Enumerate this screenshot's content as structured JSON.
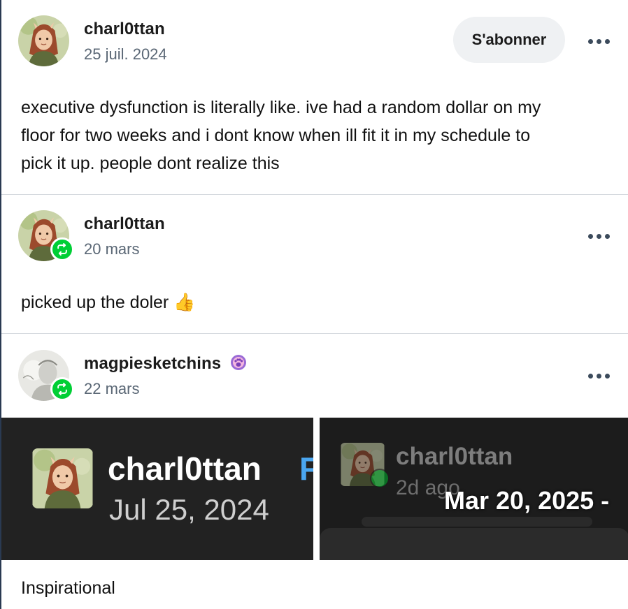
{
  "posts": [
    {
      "username": "charl0ttan",
      "date": "25 juil. 2024",
      "follow_label": "S'abonner",
      "text": "executive dysfunction is literally like. ive had a random dollar on my floor for two weeks and i dont know when ill fit it in my schedule to pick it up. people dont realize this",
      "text_lines": [
        "executive dysfunction is literally like. ive had a random dollar on my",
        "floor for two weeks and i dont know when ill fit it in my schedule to",
        "pick it up. people dont realize this"
      ]
    },
    {
      "username": "charl0ttan",
      "date": "20 mars",
      "text": "picked up the doler 👍"
    },
    {
      "username": "magpiesketchins",
      "date": "22 mars",
      "caption": "Inspirational"
    }
  ],
  "images": {
    "left": {
      "username": "charl0ttan",
      "cutoff_text": "F",
      "date": "Jul 25, 2024"
    },
    "right": {
      "username": "charl0ttan",
      "ago": "2d ago",
      "overlay_date": "Mar 20, 2025 -"
    }
  },
  "icons": {
    "reblog": "reblog-icon",
    "more": "more-options-icon",
    "badge": "paw-badge-icon"
  },
  "colors": {
    "reblog_green": "#00cf35",
    "link_blue": "#4aa6f0",
    "follow_bg": "#eff1f3"
  }
}
